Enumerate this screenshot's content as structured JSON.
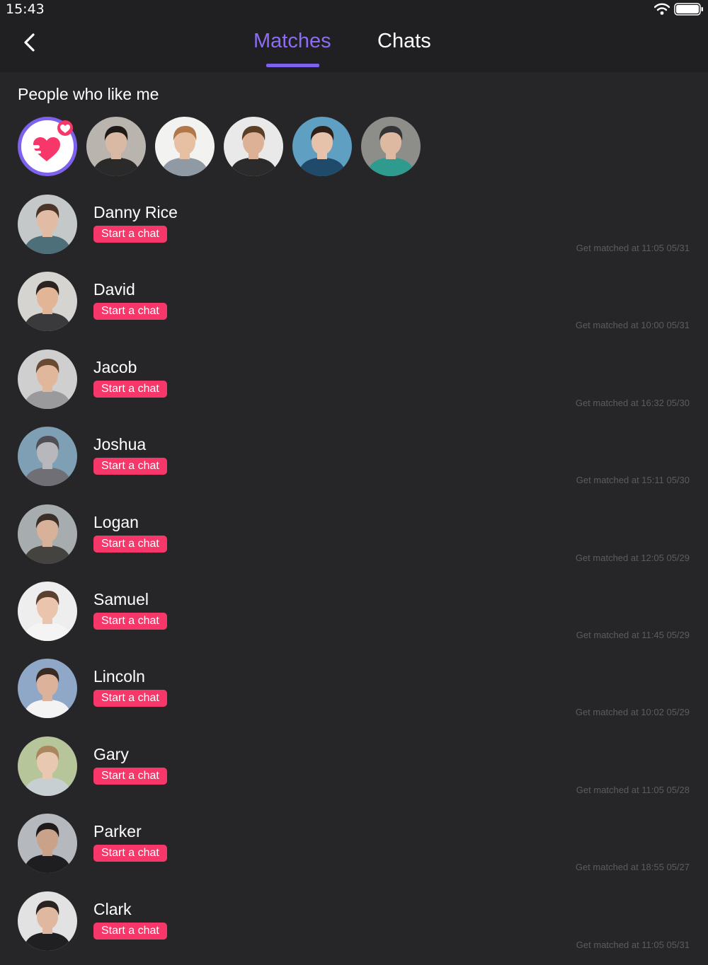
{
  "status_bar": {
    "time": "15:43",
    "wifi_icon": "wifi-icon",
    "battery_icon": "battery-icon"
  },
  "nav": {
    "back_icon": "chevron-left-icon",
    "tabs": [
      {
        "label": "Matches",
        "active": true
      },
      {
        "label": "Chats",
        "active": false
      }
    ],
    "accent": "#7e62ee"
  },
  "likes": {
    "title": "People who like me",
    "badge_icon": "heart-icon",
    "avatars": [
      {
        "bg": "#b9b4ae",
        "hair": "#1e1a18",
        "skin": "#d9b8a4",
        "shirt": "#2a2a2a"
      },
      {
        "bg": "#f2f2f0",
        "hair": "#b0774a",
        "skin": "#e7bfa3",
        "shirt": "#8f9aa5"
      },
      {
        "bg": "#e9e9ea",
        "hair": "#5b3e26",
        "skin": "#dcb196",
        "shirt": "#2b2b2b"
      },
      {
        "bg": "#5e9fc2",
        "hair": "#2f2018",
        "skin": "#e6c2aa",
        "shirt": "#1f4a6a"
      },
      {
        "bg": "#8d8e8a",
        "hair": "#343437",
        "skin": "#ddb9a1",
        "shirt": "#2f9b8f"
      }
    ]
  },
  "matches": [
    {
      "name": "Danny Rice",
      "button": "Start a chat",
      "time": "Get matched at 11:05 05/31",
      "bg": "#c5c8c9",
      "hair": "#4a3528",
      "skin": "#e1bba3",
      "shirt": "#4d6f7a"
    },
    {
      "name": "David",
      "button": "Start a chat",
      "time": "Get matched at 10:00 05/31",
      "bg": "#d5d4d1",
      "hair": "#2b2320",
      "skin": "#e3b597",
      "shirt": "#3a3a3c"
    },
    {
      "name": "Jacob",
      "button": "Start a chat",
      "time": "Get matched at 16:32 05/30",
      "bg": "#cfcfd0",
      "hair": "#6a4a33",
      "skin": "#e0b79b",
      "shirt": "#9a9a9c"
    },
    {
      "name": "Joshua",
      "button": "Start a chat",
      "time": "Get matched at 15:11 05/30",
      "bg": "#7f9fb4",
      "hair": "#4f4f55",
      "skin": "#b8b8bc",
      "shirt": "#6f6f75"
    },
    {
      "name": "Logan",
      "button": "Start a chat",
      "time": "Get matched at 12:05 05/29",
      "bg": "#a7acae",
      "hair": "#3a2e26",
      "skin": "#d7b19a",
      "shirt": "#45433f"
    },
    {
      "name": "Samuel",
      "button": "Start a chat",
      "time": "Get matched at 11:45 05/29",
      "bg": "#eeeeee",
      "hair": "#5b4030",
      "skin": "#eac4ad",
      "shirt": "#f4f4f4"
    },
    {
      "name": "Lincoln",
      "button": "Start a chat",
      "time": "Get matched at 10:02 05/29",
      "bg": "#8fa8c8",
      "hair": "#3a2b22",
      "skin": "#dcb29a",
      "shirt": "#f3f3f3"
    },
    {
      "name": "Gary",
      "button": "Start a chat",
      "time": "Get matched at 11:05 05/28",
      "bg": "#b7c59a",
      "hair": "#a9865d",
      "skin": "#e9c8b2",
      "shirt": "#c7cfd2"
    },
    {
      "name": "Parker",
      "button": "Start a chat",
      "time": "Get matched at 18:55 05/27",
      "bg": "#b5b9bd",
      "hair": "#1f1b1a",
      "skin": "#caa28a",
      "shirt": "#1e1e20"
    },
    {
      "name": "Clark",
      "button": "Start a chat",
      "time": "Get matched at 11:05 05/31",
      "bg": "#e2e2e2",
      "hair": "#2a2220",
      "skin": "#e0b89f",
      "shirt": "#202022"
    }
  ]
}
